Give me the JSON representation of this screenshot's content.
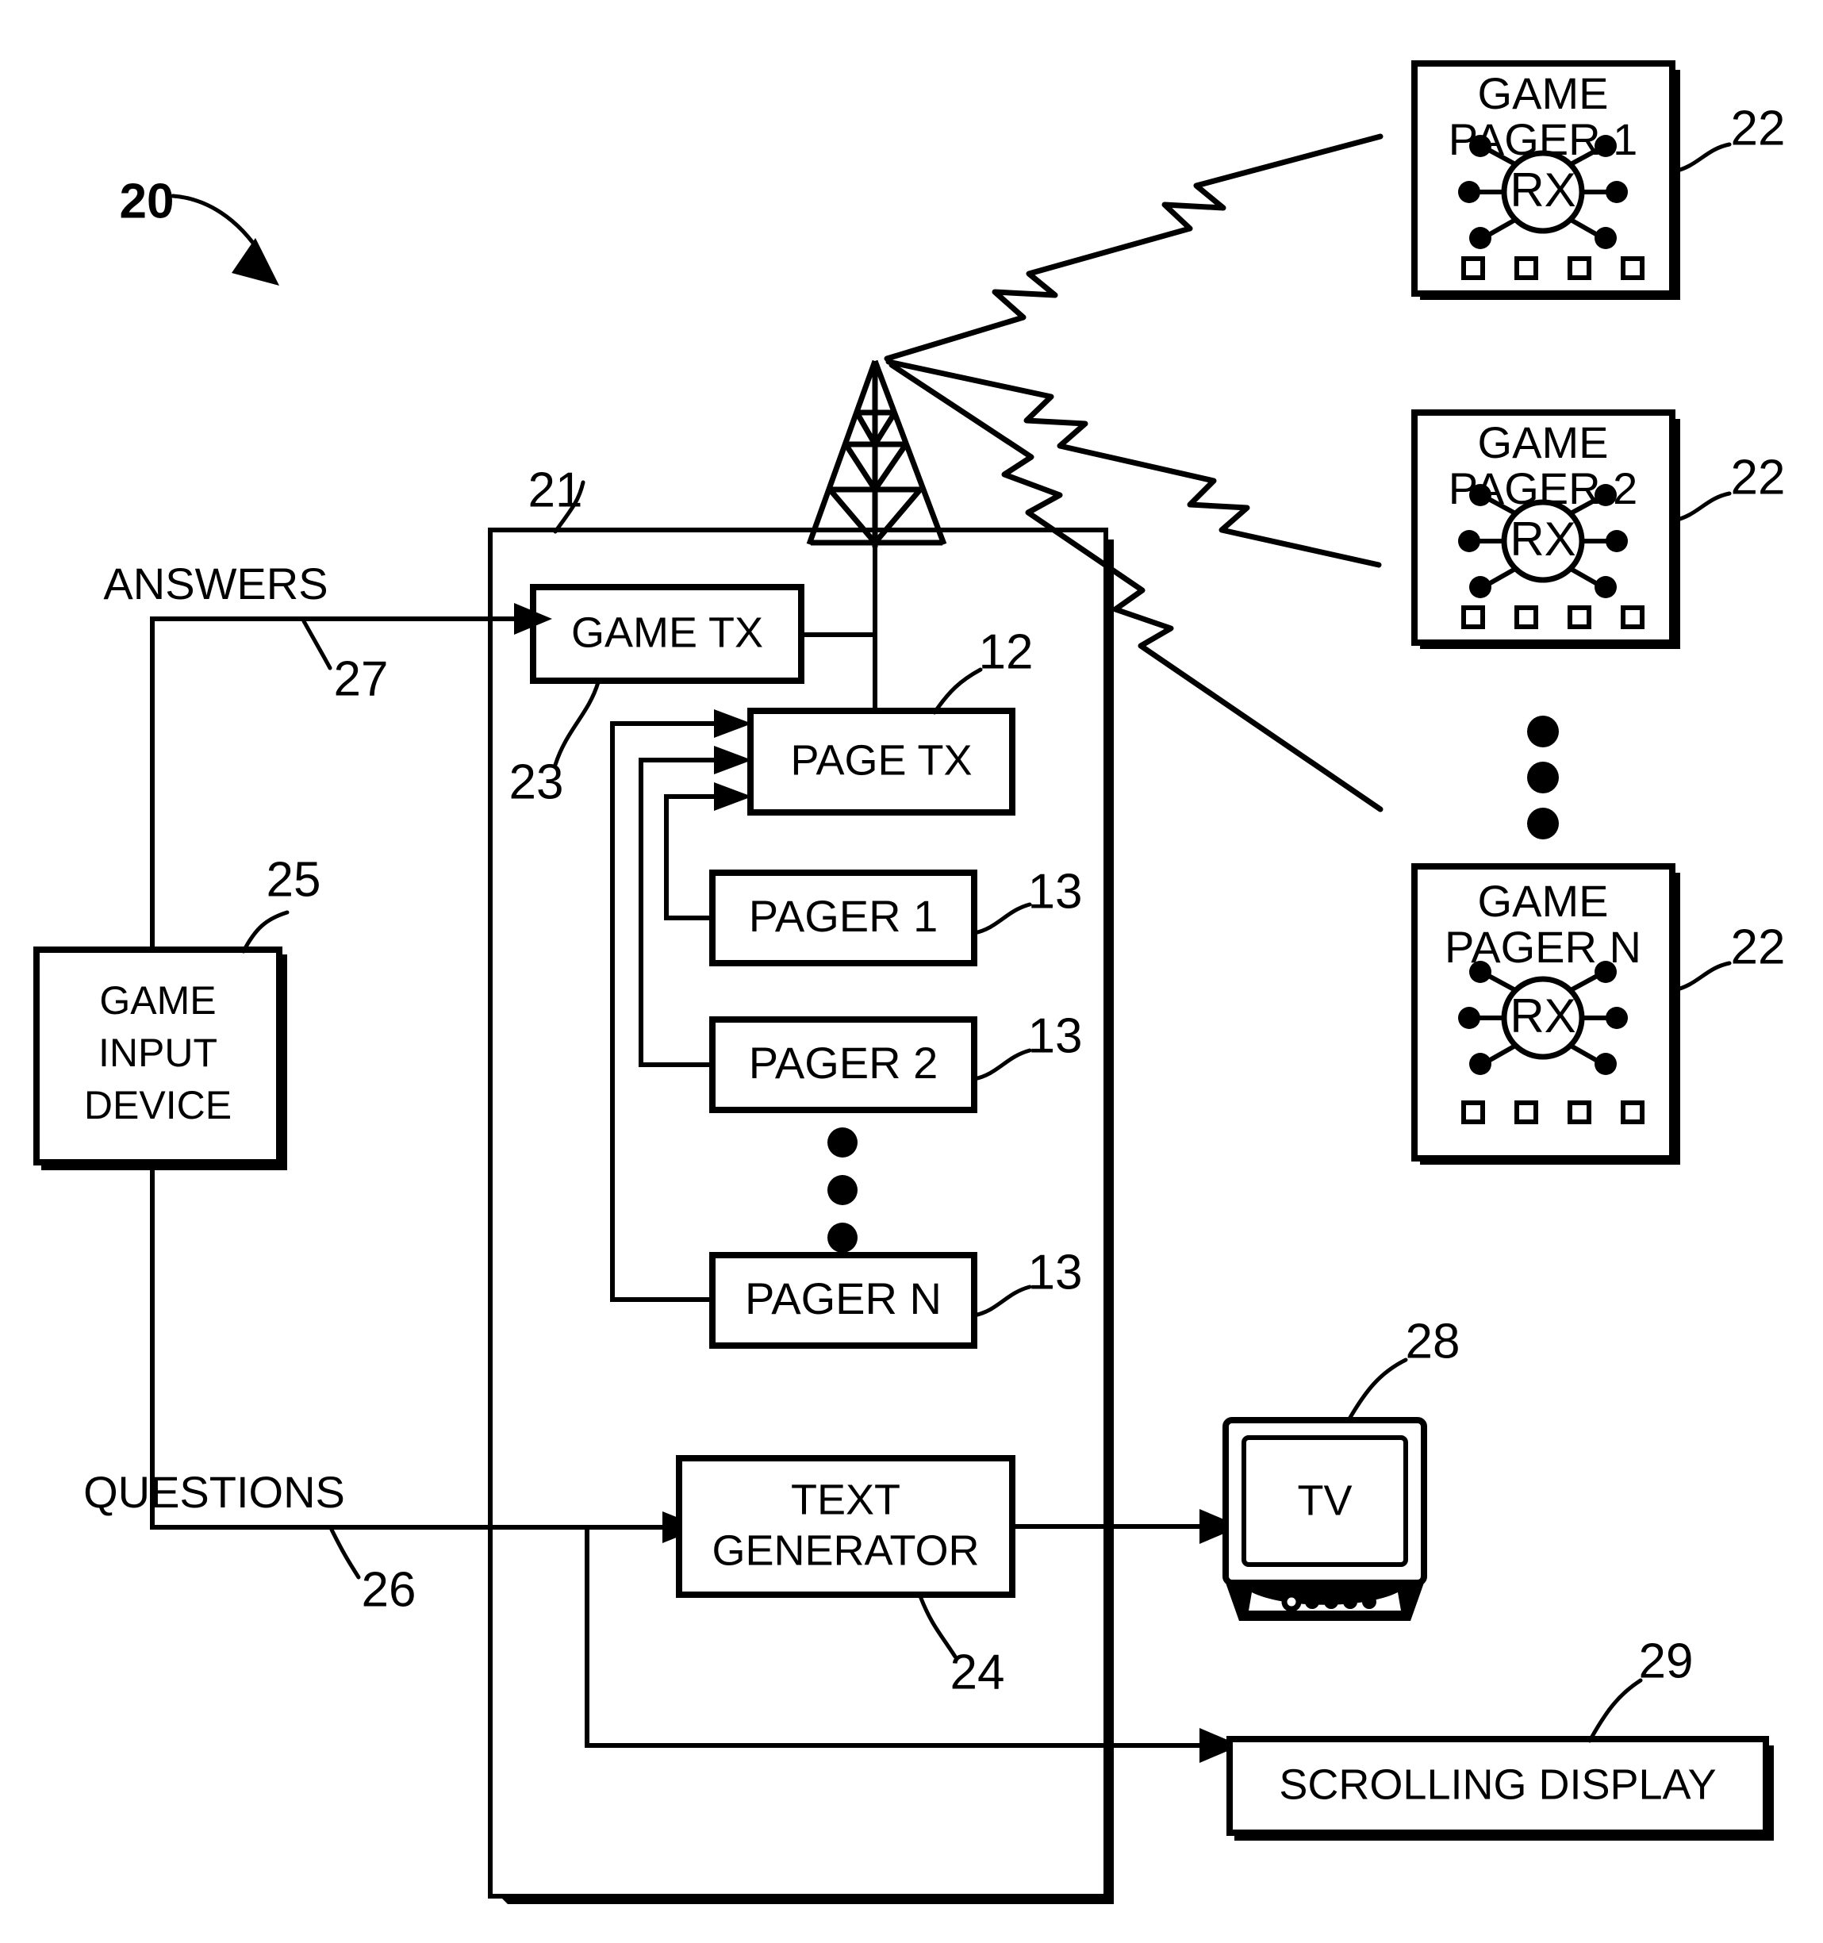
{
  "figure": {
    "reference_numeral": "20",
    "type": "system-block-diagram"
  },
  "system_box": {
    "ref": "21",
    "name": "game-system-enclosure"
  },
  "blocks": {
    "game_tx": {
      "label": "GAME TX",
      "ref": "23"
    },
    "page_tx": {
      "label": "PAGE TX",
      "ref": "12"
    },
    "pager_1": {
      "label": "PAGER 1",
      "ref": "13"
    },
    "pager_2": {
      "label": "PAGER 2",
      "ref": "13"
    },
    "pager_n": {
      "label": "PAGER N",
      "ref": "13"
    },
    "text_generator": {
      "label_line1": "TEXT",
      "label_line2": "GENERATOR",
      "ref": "24"
    },
    "game_input_device": {
      "label_line1": "GAME",
      "label_line2": "INPUT",
      "label_line3": "DEVICE",
      "ref": "25"
    },
    "tv": {
      "label": "TV",
      "ref": "28"
    },
    "scrolling_display": {
      "label": "SCROLLING DISPLAY",
      "ref": "29"
    }
  },
  "signals": {
    "answers": {
      "label": "ANSWERS",
      "ref": "27"
    },
    "questions": {
      "label": "QUESTIONS",
      "ref": "26"
    }
  },
  "game_pagers": [
    {
      "title_line1": "GAME",
      "title_line2": "PAGER 1",
      "receiver": "RX",
      "ref": "22"
    },
    {
      "title_line1": "GAME",
      "title_line2": "PAGER 2",
      "receiver": "RX",
      "ref": "22"
    },
    {
      "title_line1": "GAME",
      "title_line2": "PAGER N",
      "receiver": "RX",
      "ref": "22"
    }
  ],
  "icons": {
    "antenna_tower": "antenna-tower-icon",
    "rf_link": "rf-wireless-link-icon",
    "ellipsis_vertical": "vertical-ellipsis-icon",
    "tv_monitor": "crt-tv-icon"
  },
  "colors": {
    "ink": "#000000",
    "paper": "#ffffff"
  }
}
